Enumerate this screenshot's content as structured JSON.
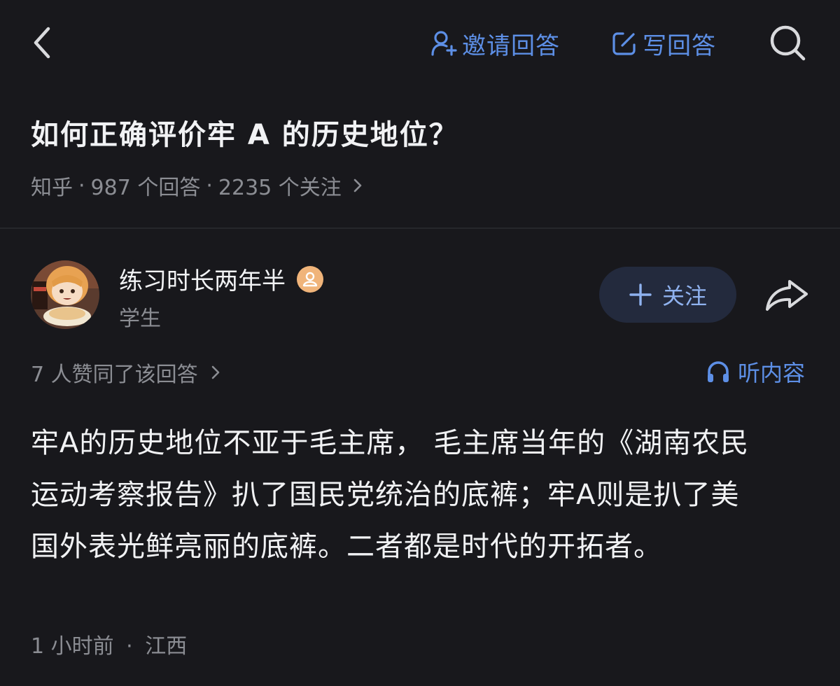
{
  "header": {
    "invite_label": "邀请回答",
    "write_label": "写回答"
  },
  "question": {
    "title": "如何正确评价牢 A 的历史地位？",
    "source": "知乎",
    "answers": "987 个回答",
    "followers": "2235 个关注",
    "separator": "·"
  },
  "answer": {
    "author_name": "练习时长两年半",
    "author_role": "学生",
    "follow_label": "关注",
    "votes_text": "7 人赞同了该回答",
    "listen_label": "听内容",
    "content_lines": [
      "牢A的历史地位不亚于毛主席， 毛主席当年的《湖南农民",
      "运动考察报告》扒了国民党统治的底裤；牢A则是扒了美",
      "国外表光鲜亮丽的底裤。二者都是时代的开拓者。"
    ],
    "time": "1 小时前",
    "location": "江西"
  },
  "colors": {
    "background": "#18181c",
    "accent": "#5d8fe6",
    "muted": "#8b8d93",
    "follow_bg": "#232a3d"
  },
  "icons": [
    "back-icon",
    "invite-user-icon",
    "edit-icon",
    "search-icon",
    "badge-icon",
    "share-icon",
    "headphones-icon",
    "chevron-right-icon",
    "plus-icon"
  ]
}
